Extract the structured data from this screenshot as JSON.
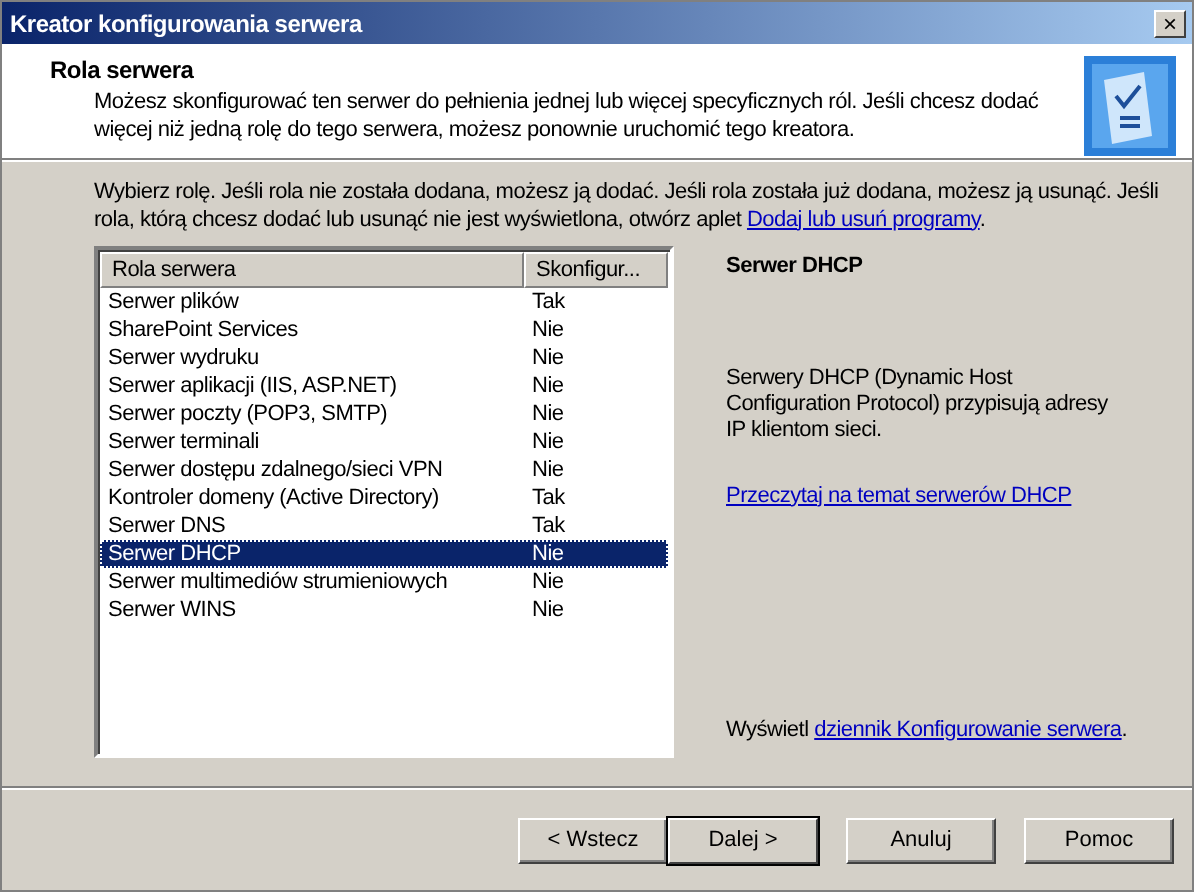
{
  "window": {
    "title": "Kreator konfigurowania serwera",
    "close": "×"
  },
  "header": {
    "title": "Rola serwera",
    "description": "Możesz skonfigurować ten serwer do pełnienia jednej lub więcej specyficznych ról. Jeśli chcesz dodać więcej niż jedną rolę do tego serwera, możesz ponownie uruchomić tego kreatora."
  },
  "instructions": {
    "text": "Wybierz rolę. Jeśli rola nie została dodana, możesz ją dodać. Jeśli rola została już dodana, możesz ją usunąć. Jeśli rola, którą chcesz dodać lub usunąć nie jest wyświetlona, otwórz aplet ",
    "link": "Dodaj lub usuń programy",
    "after": "."
  },
  "table": {
    "columns": [
      "Rola serwera",
      "Skonfigur..."
    ],
    "rows": [
      {
        "role": "Serwer plików",
        "configured": "Tak",
        "selected": false
      },
      {
        "role": "SharePoint Services",
        "configured": "Nie",
        "selected": false
      },
      {
        "role": "Serwer wydruku",
        "configured": "Nie",
        "selected": false
      },
      {
        "role": "Serwer aplikacji (IIS, ASP.NET)",
        "configured": "Nie",
        "selected": false
      },
      {
        "role": "Serwer poczty (POP3, SMTP)",
        "configured": "Nie",
        "selected": false
      },
      {
        "role": "Serwer terminali",
        "configured": "Nie",
        "selected": false
      },
      {
        "role": "Serwer dostępu zdalnego/sieci VPN",
        "configured": "Nie",
        "selected": false
      },
      {
        "role": "Kontroler domeny (Active Directory)",
        "configured": "Tak",
        "selected": false
      },
      {
        "role": "Serwer DNS",
        "configured": "Tak",
        "selected": false
      },
      {
        "role": "Serwer DHCP",
        "configured": "Nie",
        "selected": true
      },
      {
        "role": "Serwer multimediów strumieniowych",
        "configured": "Nie",
        "selected": false
      },
      {
        "role": "Serwer WINS",
        "configured": "Nie",
        "selected": false
      }
    ]
  },
  "details": {
    "title": "Serwer DHCP",
    "description": "Serwery DHCP (Dynamic Host Configuration Protocol) przypisują adresy IP klientom sieci.",
    "link": "Przeczytaj na temat serwerów DHCP",
    "footer_text": "Wyświetl ",
    "footer_link": "dziennik Konfigurowanie serwera",
    "footer_after": "."
  },
  "buttons": [
    {
      "label": "< Wstecz",
      "default": false
    },
    {
      "label": "Dalej >",
      "default": true
    },
    {
      "label": "Anuluj",
      "default": false
    },
    {
      "label": "Pomoc",
      "default": false
    }
  ]
}
